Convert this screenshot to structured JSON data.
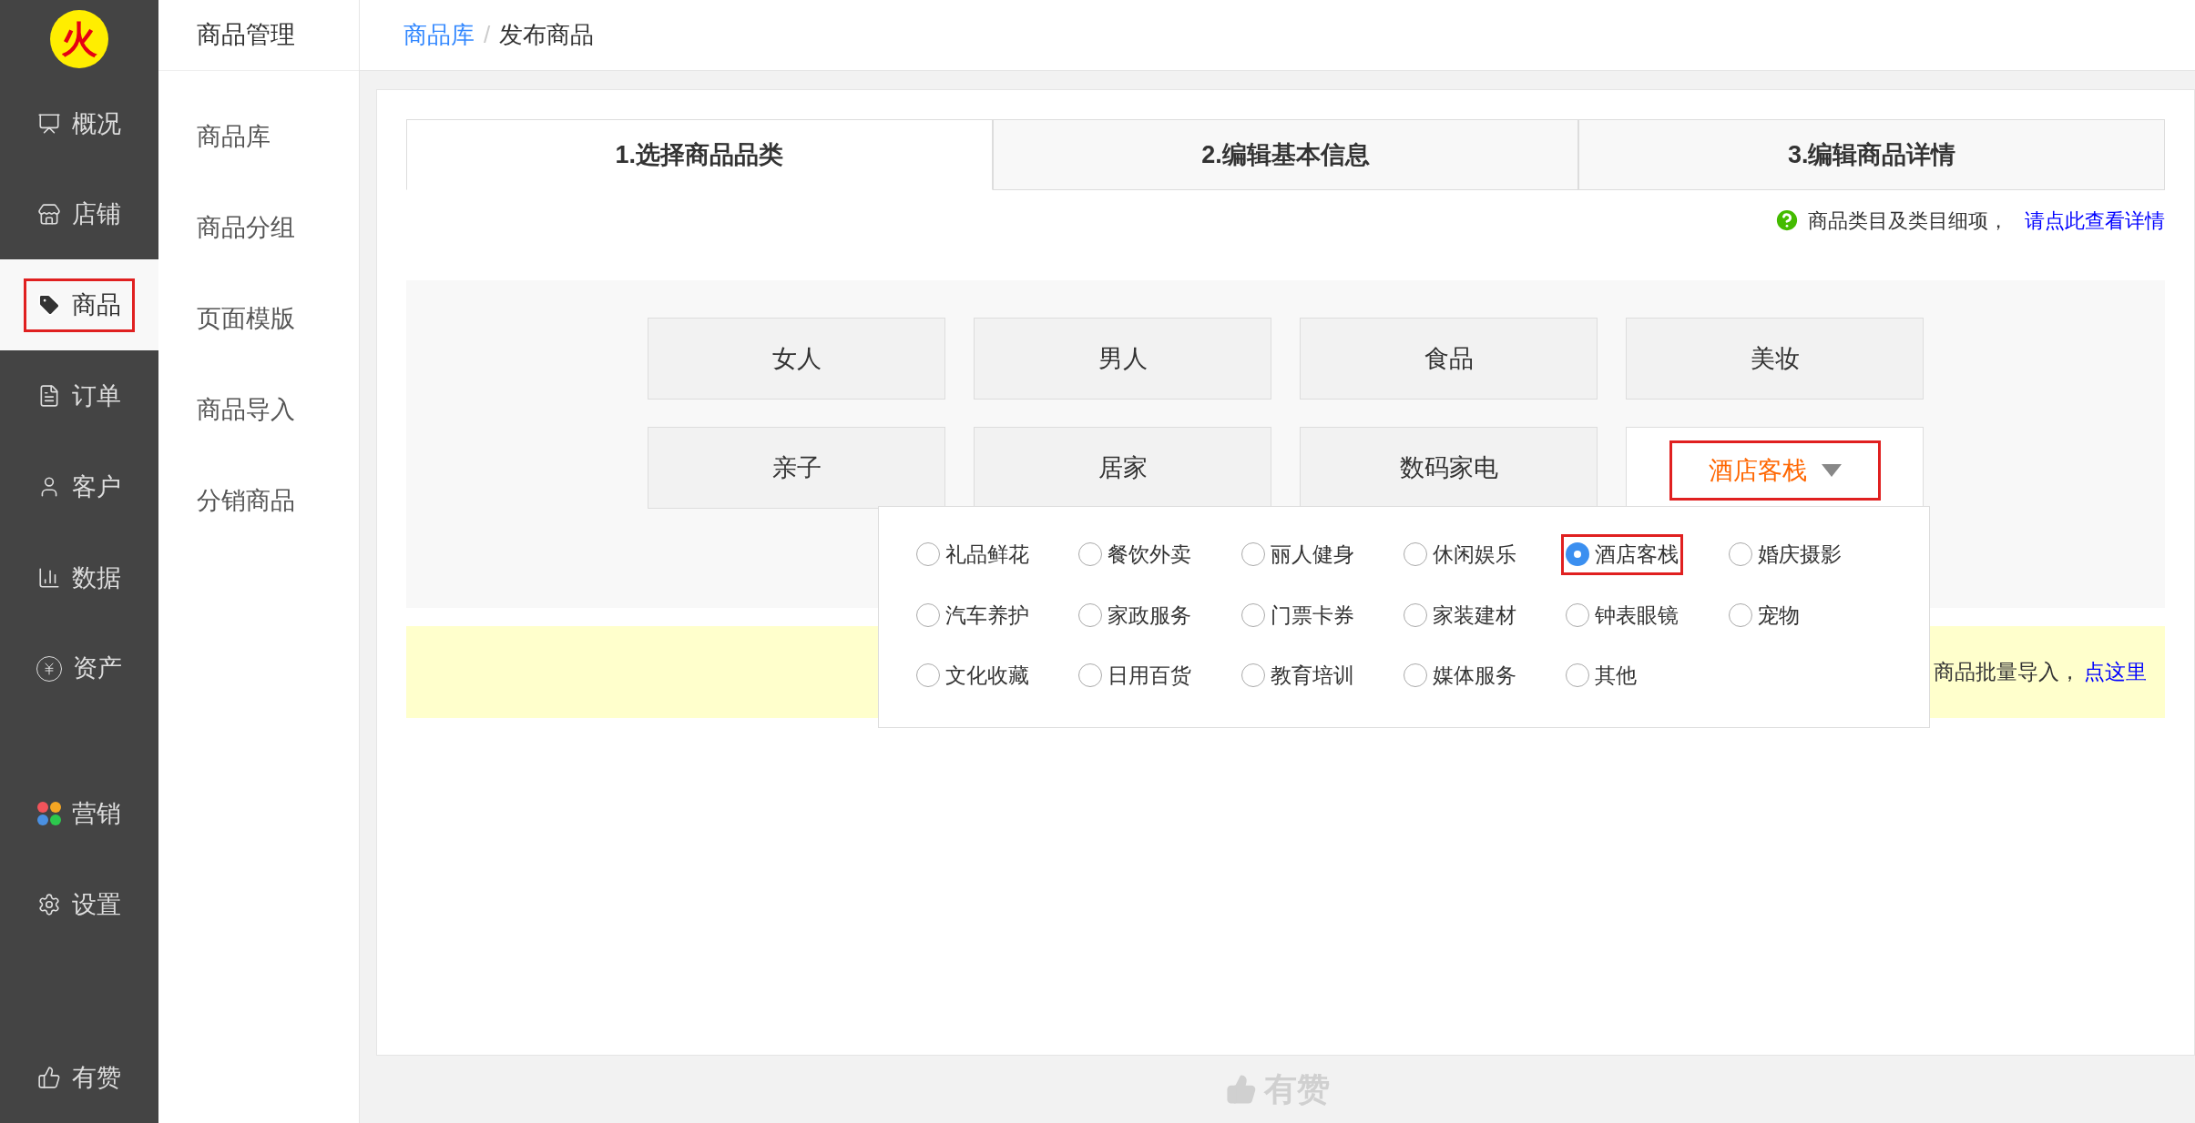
{
  "logo_text": "火",
  "nav": [
    {
      "label": "概况",
      "selected": false
    },
    {
      "label": "店铺",
      "selected": false
    },
    {
      "label": "商品",
      "selected": true
    },
    {
      "label": "订单",
      "selected": false
    },
    {
      "label": "客户",
      "selected": false
    },
    {
      "label": "数据",
      "selected": false
    },
    {
      "label": "资产",
      "selected": false
    },
    {
      "label": "营销",
      "selected": false
    },
    {
      "label": "设置",
      "selected": false
    },
    {
      "label": "有赞",
      "selected": false
    }
  ],
  "subnav": {
    "title": "商品管理",
    "items": [
      "商品库",
      "商品分组",
      "页面模版",
      "商品导入",
      "分销商品"
    ]
  },
  "breadcrumb": {
    "link": "商品库",
    "separator": "/",
    "current": "发布商品"
  },
  "steps": [
    {
      "label": "1.选择商品品类",
      "selected": true
    },
    {
      "label": "2.编辑基本信息",
      "selected": false
    },
    {
      "label": "3.编辑商品详情",
      "selected": false
    }
  ],
  "hint": {
    "text": "商品类目及类目细项，",
    "link": "请点此查看详情"
  },
  "categories": [
    {
      "label": "女人",
      "selected": false
    },
    {
      "label": "男人",
      "selected": false
    },
    {
      "label": "食品",
      "selected": false
    },
    {
      "label": "美妆",
      "selected": false
    },
    {
      "label": "亲子",
      "selected": false
    },
    {
      "label": "居家",
      "selected": false
    },
    {
      "label": "数码家电",
      "selected": false
    },
    {
      "label": "酒店客栈",
      "selected": true
    }
  ],
  "subcategories": [
    {
      "label": "礼品鲜花",
      "selected": false
    },
    {
      "label": "餐饮外卖",
      "selected": false
    },
    {
      "label": "丽人健身",
      "selected": false
    },
    {
      "label": "休闲娱乐",
      "selected": false
    },
    {
      "label": "酒店客栈",
      "selected": true
    },
    {
      "label": "婚庆摄影",
      "selected": false
    },
    {
      "label": "汽车养护",
      "selected": false
    },
    {
      "label": "家政服务",
      "selected": false
    },
    {
      "label": "门票卡券",
      "selected": false
    },
    {
      "label": "家装建材",
      "selected": false
    },
    {
      "label": "钟表眼镜",
      "selected": false
    },
    {
      "label": "宠物",
      "selected": false
    },
    {
      "label": "文化收藏",
      "selected": false
    },
    {
      "label": "日用百货",
      "selected": false
    },
    {
      "label": "教育培训",
      "selected": false
    },
    {
      "label": "媒体服务",
      "selected": false
    },
    {
      "label": "其他",
      "selected": false
    }
  ],
  "notice": {
    "text": "商品批量导入，",
    "link": "点这里"
  },
  "footer_logo": "有赞"
}
